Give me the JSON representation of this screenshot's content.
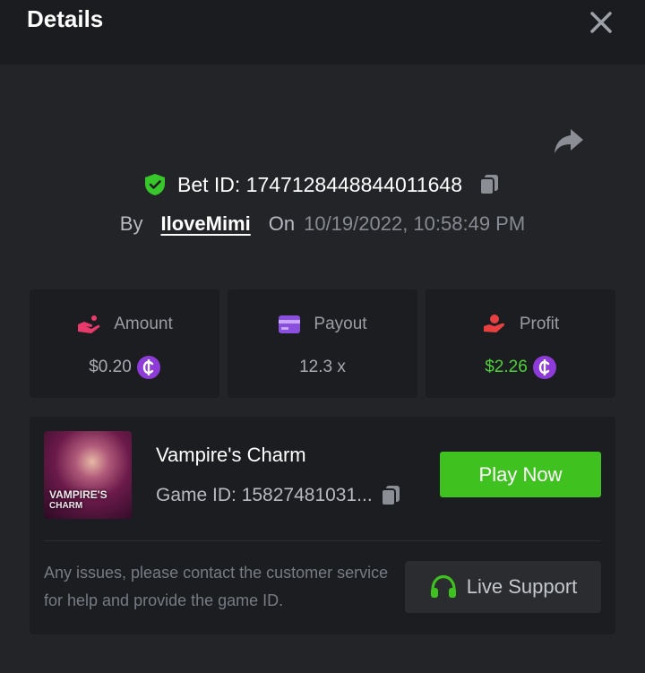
{
  "header": {
    "title": "Details"
  },
  "bet": {
    "id_text": "Bet ID: 1747128448844011648",
    "by_label": "By",
    "username": "IloveMimi",
    "on_label": "On",
    "datetime": "10/19/2022, 10:58:49 PM"
  },
  "stats": [
    {
      "label": "Amount",
      "value": "$0.20",
      "icon": "amount-hand-icon",
      "has_coin": true
    },
    {
      "label": "Payout",
      "value": "12.3 x",
      "icon": "card-icon",
      "has_coin": false
    },
    {
      "label": "Profit",
      "value": "$2.26",
      "icon": "profit-hand-icon",
      "has_coin": true
    }
  ],
  "coin_symbol": "₵",
  "game": {
    "name": "Vampire's Charm",
    "id_text": "Game ID: 15827481031...",
    "thumb_line1": "VAMPIRE'S",
    "thumb_line2": "CHARM",
    "play_label": "Play Now",
    "help_text": "Any issues, please contact the customer service for help and provide the game ID.",
    "support_label": "Live Support"
  },
  "colors": {
    "accent_green": "#3fc21f",
    "profit_green": "#4fd13a",
    "coin_purple": "#8e3bd9",
    "amount_pink": "#e83a6b",
    "payout_purple": "#8b4fe0",
    "profit_red": "#e84040"
  }
}
